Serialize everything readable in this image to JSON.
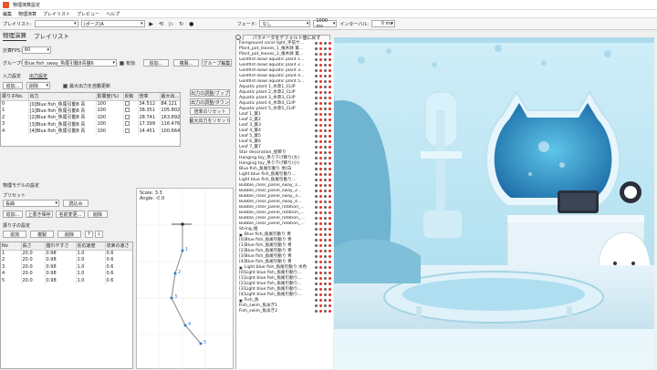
{
  "window": {
    "title": "物理演算設定"
  },
  "menu": [
    "編集",
    "物理演算",
    "プレイリスト",
    "プレビュー",
    "ヘルプ"
  ],
  "toolbar": {
    "playlist_label": "プレイリスト:",
    "playlist_value": "",
    "playlist2_value": "(ポーズ)A",
    "fade_label": "フェード:",
    "fade_value": "なし",
    "fade_ms": "1000 ms",
    "interval_label": "インターバル:",
    "interval_ms": "0 ms"
  },
  "tabs": [
    "物理演算",
    "プレイリスト"
  ],
  "left": {
    "fps_label": "計算FPS：",
    "fps_value": "60",
    "group_label": "グループ名：",
    "group_value": "Blue fish_sway_魚尾引動8青猫6",
    "enabled_label": "有効",
    "add_btn": "追加...",
    "copy_btn": "複製...",
    "group_edit_btn": "グループ編集",
    "input_section": "入力設定",
    "output_section": "出力設定",
    "add2": "追加...",
    "delete": "削除",
    "max_output_update": "最大出力を自動更新"
  },
  "out_table": {
    "headers": [
      "振り子No.",
      "出力",
      "影響度(%)",
      "反転",
      "倍率",
      "最大出..."
    ],
    "rows": [
      [
        "0",
        "[0]Blue fish_魚尾引動8 青",
        "100",
        "",
        "34.512",
        "84.121"
      ],
      [
        "1",
        "[1]Blue fish_魚尾引動8 青",
        "100",
        "",
        "38.351",
        "105.802"
      ],
      [
        "2",
        "[2]Blue fish_魚尾引動8 青",
        "100",
        "",
        "28.741",
        "163.892"
      ],
      [
        "3",
        "[3]Blue fish_魚尾引動8 青",
        "100",
        "",
        "17.399",
        "116.476"
      ],
      [
        "4",
        "[4]Blue fish_魚尾引動8 青",
        "100",
        "",
        "14.451",
        "100.664"
      ]
    ]
  },
  "out_btns": [
    "出力の調整/ブップ",
    "出力の調整/ダウン",
    "倍率のリセット",
    "最大出力をリセット"
  ],
  "model": {
    "section": "物理モデルの設定",
    "preset_label": "プリセット",
    "preset_value": "長曲",
    "load_btn": "読込み",
    "add": "追加...",
    "overwrite": "上書き保存",
    "rename": "名前変更...",
    "del": "削除",
    "pend_section": "振り子の設定",
    "padd": "追加",
    "pcopy": "複製",
    "pdel": "削除"
  },
  "pend_table": {
    "headers": [
      "No",
      "長さ",
      "揺れやすさ",
      "反応速度",
      "収束の速さ"
    ],
    "rows": [
      [
        "1",
        "20.0",
        "0.98",
        "1.0",
        "0.6"
      ],
      [
        "2",
        "20.0",
        "0.98",
        "1.0",
        "0.6"
      ],
      [
        "3",
        "20.0",
        "0.98",
        "1.0",
        "0.6"
      ],
      [
        "4",
        "20.0",
        "0.98",
        "1.0",
        "0.6"
      ],
      [
        "5",
        "20.0",
        "0.98",
        "1.0",
        "0.6"
      ]
    ]
  },
  "viz": {
    "scale": "Scale: 3.3",
    "angle": "Angle: -0.0",
    "nodes": [
      "1",
      "2",
      "3",
      "4",
      "5"
    ]
  },
  "layers": {
    "header_btn": "パラメータをデフォルト値に戻す",
    "items": [
      {
        "t": "Foreground coral light_手前サ...",
        "g": 0
      },
      {
        "t": "Plant_pot_leaves_1_植木鉢 葉...",
        "g": 0
      },
      {
        "t": "Plant_pot_leaves_2_植木鉢 葉...",
        "g": 0
      },
      {
        "t": "Goldfish bowl aquatic plant 1...",
        "g": 0
      },
      {
        "t": "Goldfish bowl aquatic plant 2...",
        "g": 0
      },
      {
        "t": "Goldfish bowl aquatic plant 3...",
        "g": 0
      },
      {
        "t": "Goldfish bowl aquatic plant 4...",
        "g": 0
      },
      {
        "t": "Goldfish bowl aquatic plant 5...",
        "g": 0
      },
      {
        "t": "Aquatic plant 1_水草1_CLIP",
        "g": 0
      },
      {
        "t": "Aquatic plant 2_水草2_CLIP",
        "g": 0
      },
      {
        "t": "Aquatic plant 3_水草3_CLIP",
        "g": 0
      },
      {
        "t": "Aquatic plant 4_水草4_CLIP",
        "g": 0
      },
      {
        "t": "Aquatic plant 5_水草5_CLIP",
        "g": 0
      },
      {
        "t": "Leaf 1_葉1",
        "g": 0
      },
      {
        "t": "Leaf 2_葉2",
        "g": 0
      },
      {
        "t": "Leaf 3_葉3",
        "g": 0
      },
      {
        "t": "Leaf 4_葉4",
        "g": 0
      },
      {
        "t": "Leaf 5_葉5",
        "g": 0
      },
      {
        "t": "Leaf 6_葉6",
        "g": 0
      },
      {
        "t": "Leaf 7_葉7",
        "g": 0
      },
      {
        "t": "Star decoration_星飾り",
        "g": 0
      },
      {
        "t": "Hanging toy_吊り下げ飾り(大)",
        "g": 0
      },
      {
        "t": "Hanging toy_吊り下げ飾り(小)",
        "g": 0
      },
      {
        "t": "Blue fish_魚尾引動り 黒(白",
        "g": 0
      },
      {
        "t": "Light blue fish_魚尾引動り...",
        "g": 0
      },
      {
        "t": "Light blue fish_魚尾引動り...",
        "g": 0
      },
      {
        "t": "Bubble_clear_panel_sway_1...",
        "g": 0
      },
      {
        "t": "Bubble_clear_panel_sway_2...",
        "g": 0
      },
      {
        "t": "Bubble_clear_panel_sway_3...",
        "g": 0
      },
      {
        "t": "Bubble_clear_panel_sway_4...",
        "g": 0
      },
      {
        "t": "Bubble_clear_panel_rotation_...",
        "g": 0
      },
      {
        "t": "Bubble_clear_panel_rotation_...",
        "g": 0
      },
      {
        "t": "Bubble_clear_panel_rotation_...",
        "g": 0
      },
      {
        "t": "Bubble_clear_panel_rotation_...",
        "g": 0
      },
      {
        "t": "String_紐",
        "g": 0
      },
      {
        "t": "Blue fish_魚尾引動り 青",
        "g": 1
      },
      {
        "t": "[0]Blue fish_魚尾引動り 青",
        "g": 0
      },
      {
        "t": "[1]Blue fish_魚尾引動り 青",
        "g": 0
      },
      {
        "t": "[2]Blue fish_魚尾引動り 青",
        "g": 0
      },
      {
        "t": "[3]Blue fish_魚尾引動り 青",
        "g": 0
      },
      {
        "t": "[4]Blue fish_魚尾引動り 青",
        "g": 0
      },
      {
        "t": "Light blue fish_魚尾引動り 水色",
        "g": 1
      },
      {
        "t": "[0]Light blue fish_魚尾引動り...",
        "g": 0
      },
      {
        "t": "[1]Light blue fish_魚尾引動り...",
        "g": 0
      },
      {
        "t": "[2]Light blue fish_魚尾引動り...",
        "g": 0
      },
      {
        "t": "[3]Light blue fish_魚尾引動り...",
        "g": 0
      },
      {
        "t": "[4]Light blue fish_魚尾引動り...",
        "g": 0
      },
      {
        "t": "Fish_魚",
        "g": 1
      },
      {
        "t": "Fish_swim_魚泳ぎ1",
        "g": 0
      },
      {
        "t": "Fish_swim_魚泳ぎ2",
        "g": 0
      }
    ]
  }
}
